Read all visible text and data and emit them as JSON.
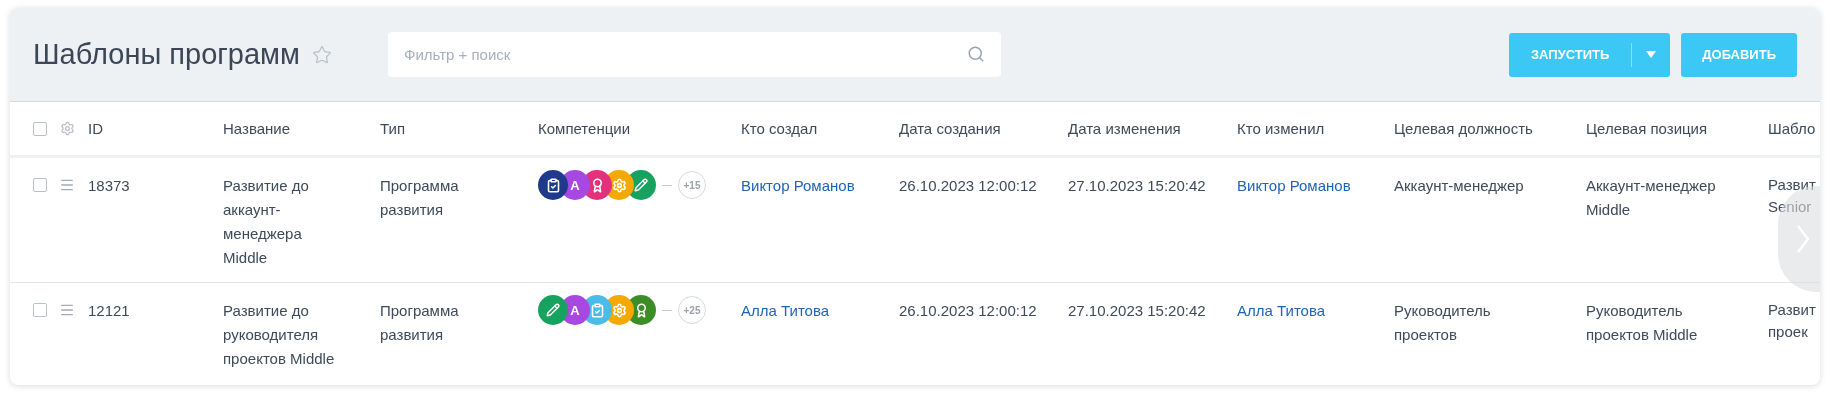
{
  "title": "Шаблоны программ",
  "favorite": false,
  "search": {
    "placeholder": "Фильтр + поиск"
  },
  "buttons": [
    {
      "label": "ЗАПУСТИТЬ",
      "kind": "split"
    },
    {
      "label": "ДОБАВИТЬ",
      "kind": "plain"
    }
  ],
  "table": {
    "select_all_checked": false,
    "columns": [
      "ID",
      "Название",
      "Тип",
      "Компетенции",
      "Кто создал",
      "Дата создания",
      "Дата изменения",
      "Кто изменил",
      "Целевая должность",
      "Целевая позиция",
      "Шабло"
    ],
    "rows": [
      {
        "checked": false,
        "id": "18373",
        "name": "Развитие до аккаунт-менеджера Middle",
        "type": "Программа развития",
        "competencies": [
          {
            "kind": "clipboard",
            "color": "#1f3a8a"
          },
          {
            "kind": "letter",
            "text": "A",
            "color": "#a748e0"
          },
          {
            "kind": "medal",
            "color": "#e2327c"
          },
          {
            "kind": "gear",
            "color": "#f5a800"
          },
          {
            "kind": "pencil",
            "color": "#17a35f"
          }
        ],
        "more": "+15",
        "created_by": "Виктор Романов",
        "created": "26.10.2023 12:00:12",
        "modified": "27.10.2023 15:20:42",
        "modified_by": "Виктор Романов",
        "target_role": "Аккаунт-менеджер",
        "target_position": "Аккаунт-менеджер Middle",
        "column_11": [
          "Развит",
          "Senior"
        ]
      },
      {
        "checked": false,
        "id": "12121",
        "name": "Развитие до руководителя проектов Middle",
        "type": "Программа развития",
        "competencies": [
          {
            "kind": "pencil",
            "color": "#17a35f"
          },
          {
            "kind": "letter",
            "text": "A",
            "color": "#a748e0"
          },
          {
            "kind": "clipboard",
            "color": "#4bbbe8"
          },
          {
            "kind": "gear",
            "color": "#f5a800"
          },
          {
            "kind": "medal",
            "color": "#3d8d27"
          }
        ],
        "more": "+25",
        "created_by": "Алла Титова",
        "created": "26.10.2023 12:00:12",
        "modified": "27.10.2023 15:20:42",
        "modified_by": "Алла Титова",
        "target_role": "Руководитель проектов",
        "target_position": "Руководитель проектов Middle",
        "column_11": [
          "Развит",
          "проек"
        ]
      }
    ]
  }
}
